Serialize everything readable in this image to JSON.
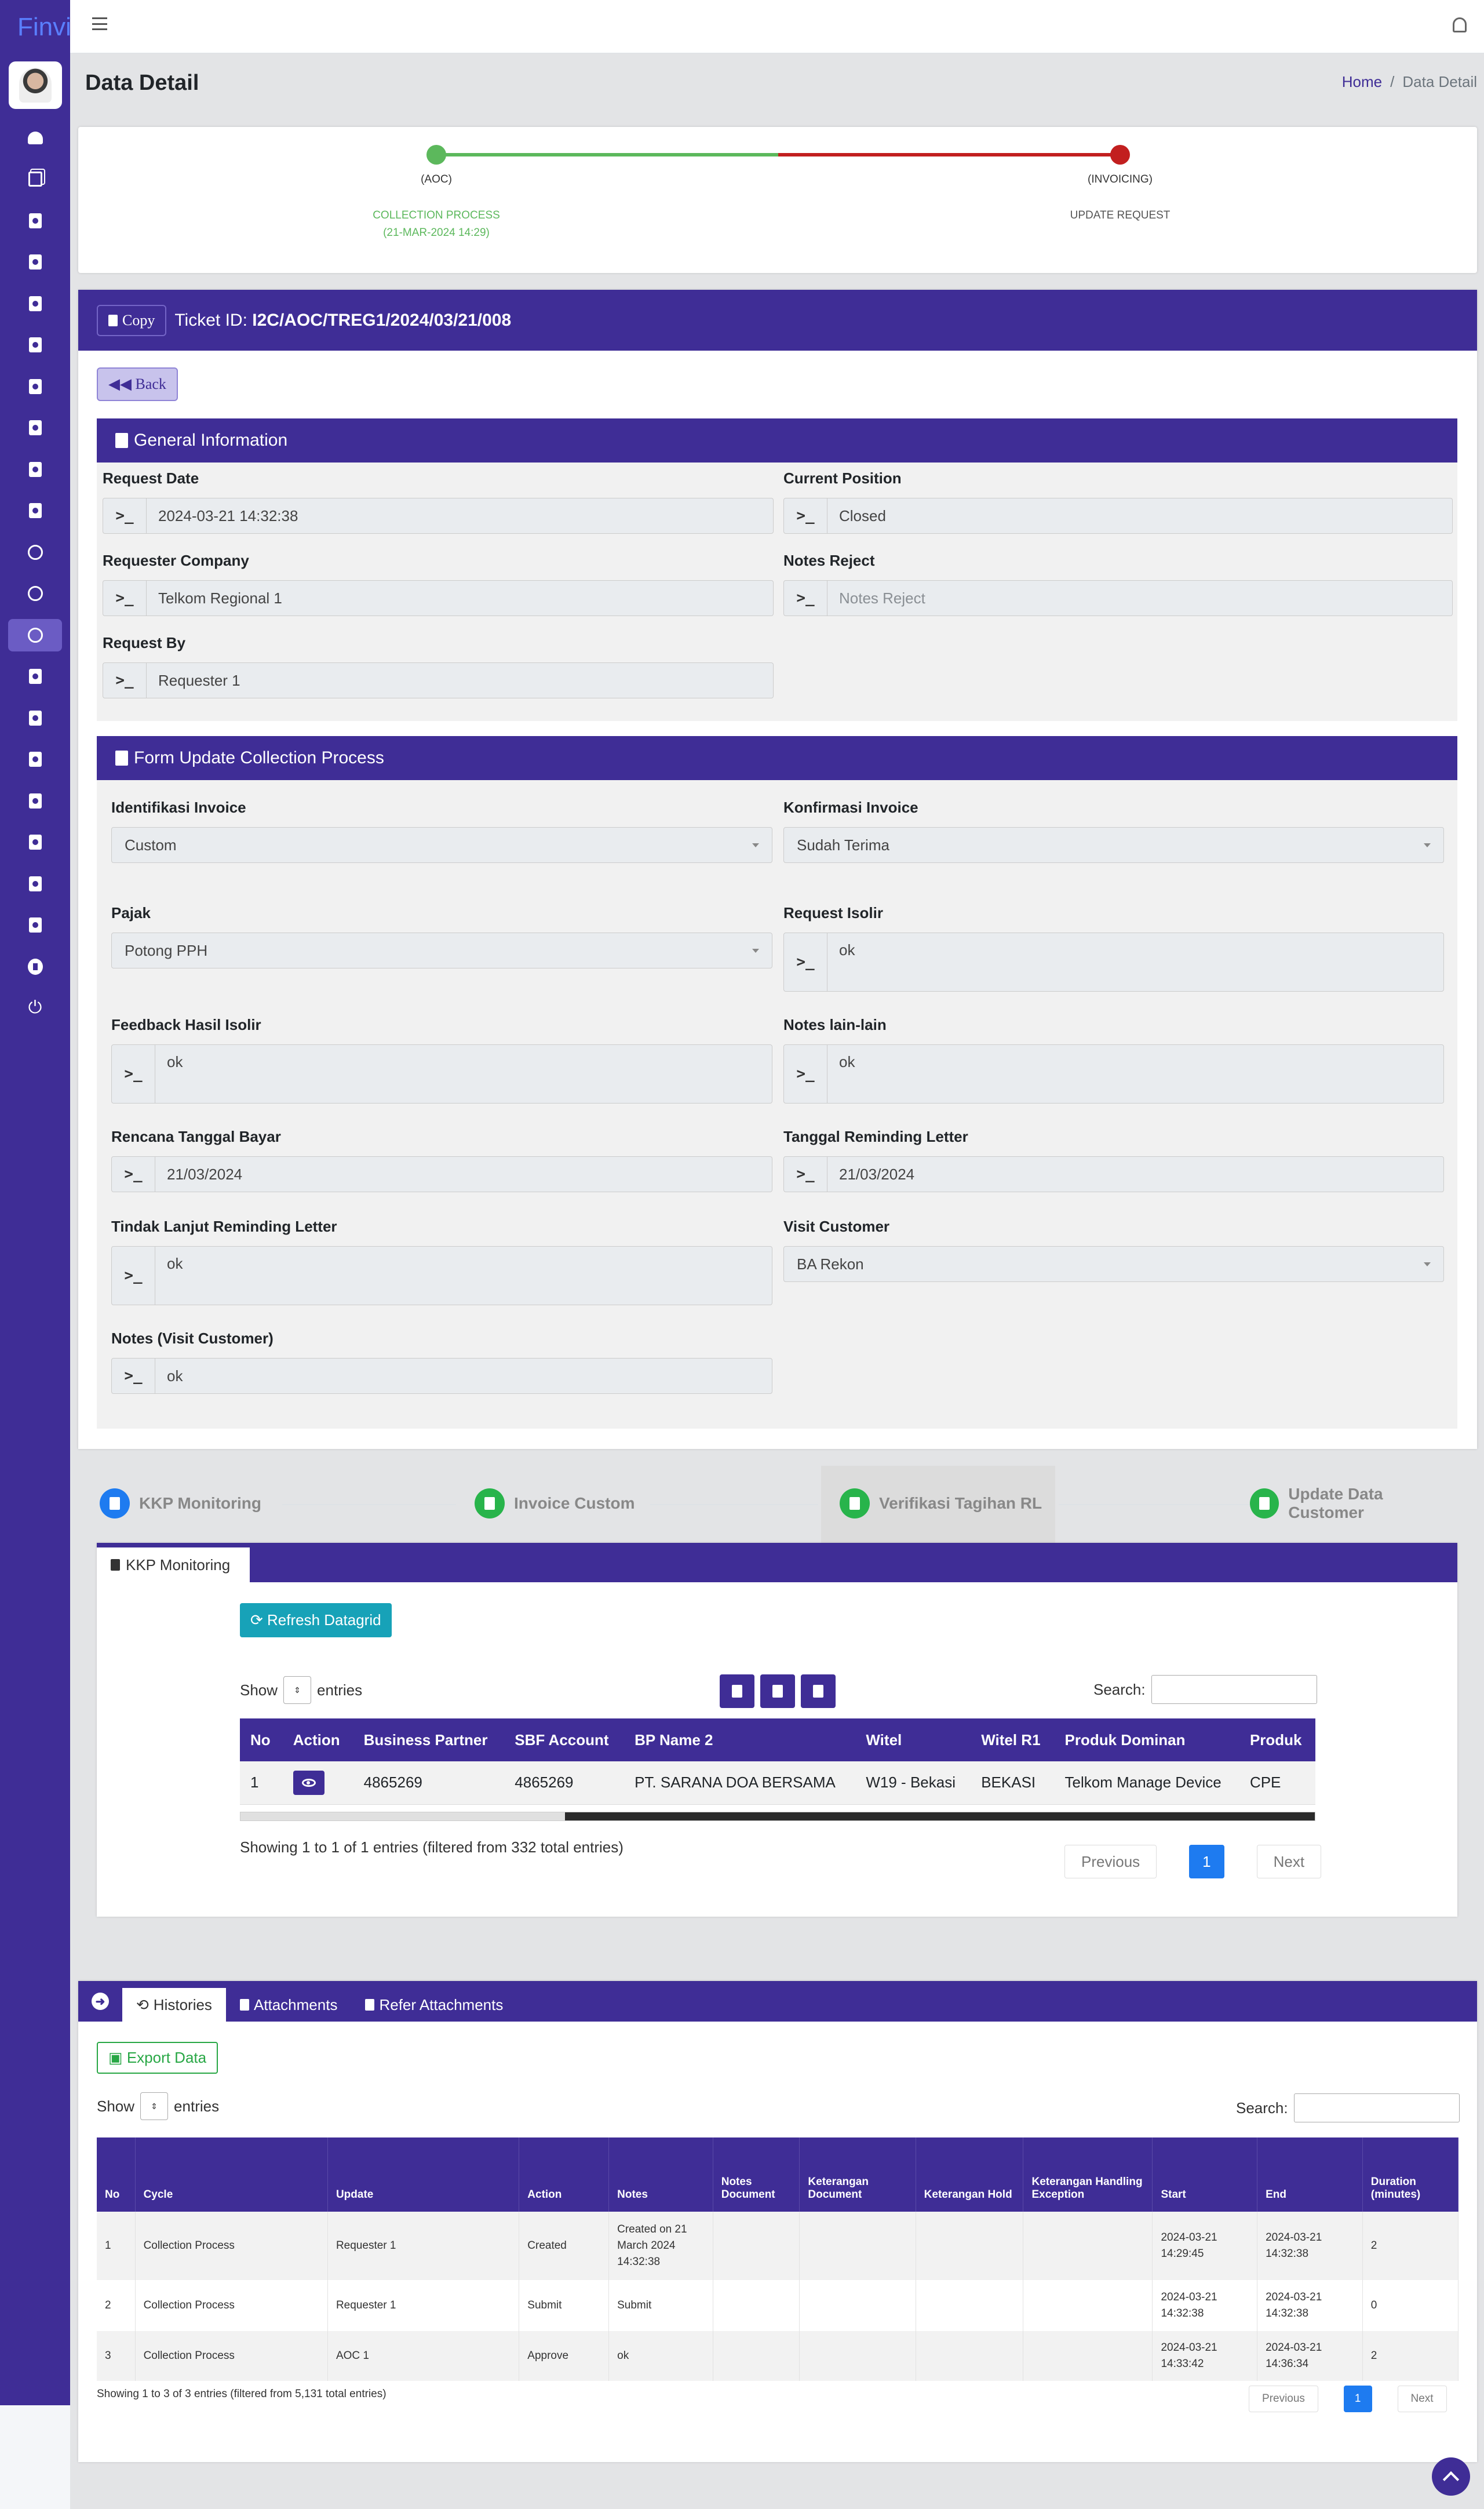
{
  "app": {
    "brand": "Finvi"
  },
  "breadcrumb": {
    "home": "Home",
    "current": "Data Detail"
  },
  "page": {
    "title": "Data Detail"
  },
  "tracker": {
    "step1_label": "(AOC)",
    "step1_sub1": "COLLECTION PROCESS",
    "step1_sub2": "(21-MAR-2024 14:29)",
    "step2_label": "(INVOICING)",
    "step2_sub": "UPDATE REQUEST",
    "colors": {
      "done": "#5cb85c",
      "current": "#c21f1f"
    }
  },
  "ticket": {
    "copy_label": "Copy",
    "id_label": "Ticket ID:",
    "id_value": "I2C/AOC/TREG1/2024/03/21/008",
    "back_label": "Back"
  },
  "general": {
    "title": "General Information",
    "request_date_label": "Request Date",
    "request_date": "2024-03-21 14:32:38",
    "current_position_label": "Current Position",
    "current_position": "Closed",
    "requester_company_label": "Requester Company",
    "requester_company": "Telkom Regional 1",
    "notes_reject_label": "Notes Reject",
    "notes_reject_placeholder": "Notes Reject",
    "request_by_label": "Request By",
    "request_by": "Requester 1"
  },
  "form": {
    "title": "Form Update Collection Process",
    "identifikasi_label": "Identifikasi Invoice",
    "identifikasi": "Custom",
    "konfirmasi_label": "Konfirmasi Invoice",
    "konfirmasi": "Sudah Terima",
    "pajak_label": "Pajak",
    "pajak": "Potong PPH",
    "request_isolir_label": "Request Isolir",
    "request_isolir": "ok",
    "feedback_label": "Feedback Hasil Isolir",
    "feedback": "ok",
    "notes_lain_label": "Notes lain-lain",
    "notes_lain": "ok",
    "rencana_label": "Rencana Tanggal Bayar",
    "rencana": "21/03/2024",
    "tanggal_rl_label": "Tanggal Reminding Letter",
    "tanggal_rl": "21/03/2024",
    "tindak_label": "Tindak Lanjut Reminding Letter",
    "tindak": "ok",
    "visit_label": "Visit Customer",
    "visit": "BA Rekon",
    "notes_visit_label": "Notes (Visit Customer)",
    "notes_visit": "ok"
  },
  "steps": [
    {
      "label": "KKP Monitoring"
    },
    {
      "label": "Invoice Custom"
    },
    {
      "label": "Verifikasi Tagihan RL"
    },
    {
      "label": "Update Data Customer"
    }
  ],
  "kkp": {
    "tab_label": "KKP Monitoring",
    "refresh_label": "Refresh Datagrid",
    "show_label": "Show",
    "entries_label": "entries",
    "search_label": "Search:",
    "columns": [
      "No",
      "Action",
      "Business Partner",
      "SBF Account",
      "BP Name 2",
      "Witel",
      "Witel R1",
      "Produk Dominan",
      "Produk"
    ],
    "rows": [
      {
        "no": "1",
        "bp": "4865269",
        "sbf": "4865269",
        "name": "PT. SARANA DOA BERSAMA",
        "witel": "W19 - Bekasi",
        "witel_r1": "BEKASI",
        "produk_dominan": "Telkom Manage Device",
        "produk": "CPE"
      }
    ],
    "info": "Showing 1 to 1 of 1 entries (filtered from 332 total entries)",
    "prev": "Previous",
    "page": "1",
    "next": "Next"
  },
  "histories": {
    "tabs": [
      "Histories",
      "Attachments",
      "Refer Attachments"
    ],
    "export_label": "Export Data",
    "show_label": "Show",
    "entries_label": "entries",
    "search_label": "Search:",
    "columns": [
      "No",
      "Cycle",
      "Update",
      "Action",
      "Notes",
      "Notes Document",
      "Keterangan Document",
      "Keterangan Hold",
      "Keterangan Handling Exception",
      "Start",
      "End",
      "Duration (minutes)"
    ],
    "rows": [
      {
        "no": "1",
        "cycle": "Collection Process",
        "update": "Requester 1",
        "action": "Created",
        "notes": "Created on 21 March 2024 14:32:38",
        "start": "2024-03-21 14:29:45",
        "end": "2024-03-21 14:32:38",
        "duration": "2"
      },
      {
        "no": "2",
        "cycle": "Collection Process",
        "update": "Requester 1",
        "action": "Submit",
        "notes": "Submit",
        "start": "2024-03-21 14:32:38",
        "end": "2024-03-21 14:32:38",
        "duration": "0"
      },
      {
        "no": "3",
        "cycle": "Collection Process",
        "update": "AOC 1",
        "action": "Approve",
        "notes": "ok",
        "start": "2024-03-21 14:33:42",
        "end": "2024-03-21 14:36:34",
        "duration": "2"
      }
    ],
    "info": "Showing 1 to 3 of 3 entries (filtered from 5,131 total entries)",
    "prev": "Previous",
    "page": "1",
    "next": "Next"
  }
}
